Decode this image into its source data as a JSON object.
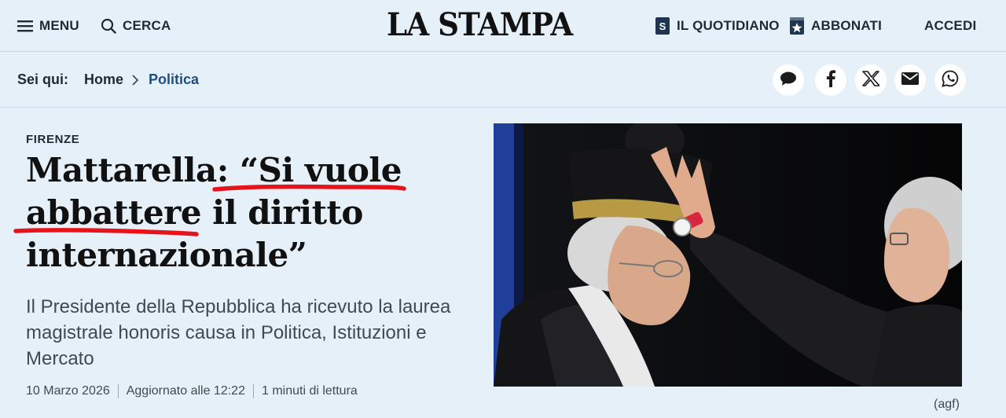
{
  "header": {
    "menu_label": "MENU",
    "search_label": "CERCA",
    "logo_text": "LA STAMPA",
    "quotidiano_label": "IL QUOTIDIANO",
    "abbonati_label": "ABBONATI",
    "accedi_label": "ACCEDI"
  },
  "breadcrumb": {
    "prefix": "Sei qui:",
    "home": "Home",
    "current": "Politica"
  },
  "share": [
    "comment-icon",
    "facebook-icon",
    "x-icon",
    "email-icon",
    "whatsapp-icon"
  ],
  "article": {
    "kicker": "FIRENZE",
    "headline": "Mattarella: “Si vuole abbattere il diritto internazionale”",
    "subtitle": "Il Presidente della Repubblica ha ricevuto la laurea magistrale honoris causa in Politica, Istituzioni e Mercato",
    "date": "10 Marzo 2026",
    "updated": "Aggiornato alle 12:22",
    "reading_time": "1 minuti di lettura",
    "photo_credit": "(agf)"
  },
  "colors": {
    "background": "#e6f0f8",
    "link": "#1e4e82",
    "annotation_red": "#e8121b"
  }
}
